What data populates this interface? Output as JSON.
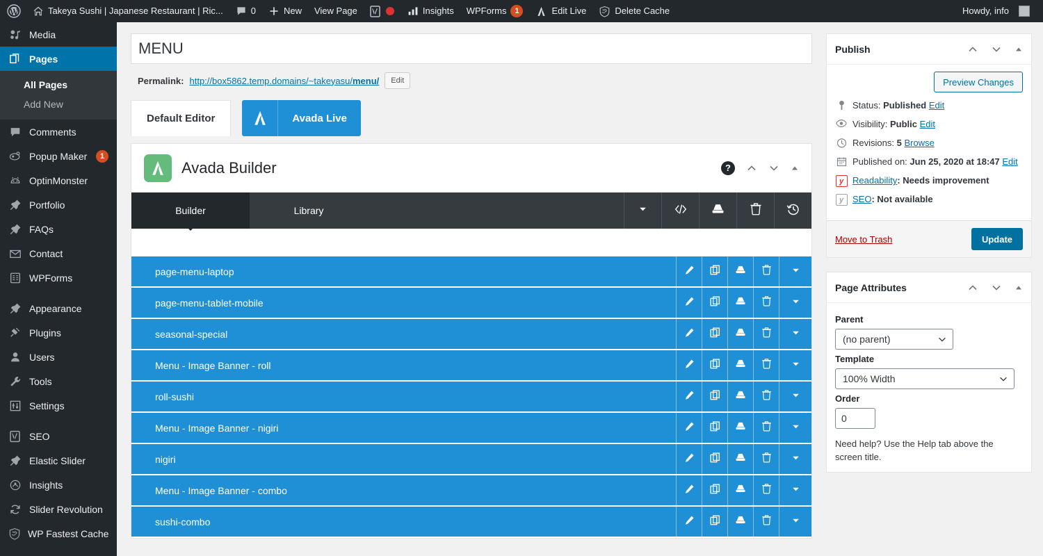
{
  "adminbar": {
    "wp_logo_icon": "wordpress-logo-icon",
    "site_icon": "home-icon",
    "site_title": "Takeya Sushi | Japanese Restaurant | Ric...",
    "comments_icon": "comment-bubble-icon",
    "comments_count": "0",
    "new_icon": "plus-icon",
    "new_label": "New",
    "view_page_label": "View Page",
    "yoast_icon": "yoast-seo-icon",
    "yoast_status_icon": "red-dot-icon",
    "insights_icon": "bar-chart-icon",
    "insights_label": "Insights",
    "wpforms_label": "WPForms",
    "wpforms_badge": "1",
    "edit_live_icon": "avada-icon",
    "edit_live_label": "Edit Live",
    "delete_cache_icon": "wp-fastest-cache-icon",
    "delete_cache_label": "Delete Cache",
    "howdy_label": "Howdy, info",
    "avatar_name": "user-avatar"
  },
  "sidebar": {
    "items": [
      {
        "label": "Media",
        "icon": "media-icon",
        "current": false
      },
      {
        "label": "Pages",
        "icon": "pages-icon",
        "current": true
      },
      {
        "label": "Comments",
        "icon": "comment-icon",
        "current": false
      },
      {
        "label": "Popup Maker",
        "icon": "popup-maker-icon",
        "current": false,
        "badge": "1"
      },
      {
        "label": "OptinMonster",
        "icon": "optinmonster-icon",
        "current": false
      },
      {
        "label": "Portfolio",
        "icon": "pin-icon",
        "current": false
      },
      {
        "label": "FAQs",
        "icon": "pin-icon",
        "current": false
      },
      {
        "label": "Contact",
        "icon": "envelope-icon",
        "current": false
      },
      {
        "label": "WPForms",
        "icon": "wpforms-icon",
        "current": false
      },
      {
        "label": "Appearance",
        "icon": "paintbrush-icon",
        "current": false,
        "separator_before": true
      },
      {
        "label": "Plugins",
        "icon": "plug-icon",
        "current": false
      },
      {
        "label": "Users",
        "icon": "user-icon",
        "current": false
      },
      {
        "label": "Tools",
        "icon": "wrench-icon",
        "current": false
      },
      {
        "label": "Settings",
        "icon": "settings-sliders-icon",
        "current": false
      },
      {
        "label": "SEO",
        "icon": "yoast-seo-icon",
        "current": false,
        "separator_before": true
      },
      {
        "label": "Elastic Slider",
        "icon": "pin-icon",
        "current": false
      },
      {
        "label": "Insights",
        "icon": "insights-icon",
        "current": false
      },
      {
        "label": "Slider Revolution",
        "icon": "refresh-icon",
        "current": false
      },
      {
        "label": "WP Fastest Cache",
        "icon": "wp-fastest-cache-icon",
        "current": false
      }
    ],
    "submenu": [
      {
        "label": "All Pages",
        "current": true
      },
      {
        "label": "Add New",
        "current": false
      }
    ]
  },
  "editor": {
    "title_value": "MENU",
    "title_placeholder": "Add title",
    "permalink_label": "Permalink:",
    "permalink_prefix": "http://box5862.temp.domains/~takeyasu/",
    "permalink_slug": "menu/",
    "permalink_edit_label": "Edit",
    "default_editor_label": "Default Editor",
    "avada_live_label": "Avada Live",
    "avada_live_icon": "avada-icon"
  },
  "builder": {
    "logo_icon": "avada-logo-icon",
    "title": "Avada Builder",
    "help_icon": "help-question-icon",
    "collapse_up_icon": "chevron-up-icon",
    "collapse_down_icon": "chevron-down-icon",
    "toggle_icon": "triangle-up-icon",
    "tabs": [
      {
        "label": "Builder",
        "active": true
      },
      {
        "label": "Library",
        "active": false
      }
    ],
    "tools": [
      {
        "name": "dropdown-toggle",
        "icon": "caret-down-icon"
      },
      {
        "name": "code-block",
        "icon": "code-icon"
      },
      {
        "name": "save-to-library",
        "icon": "save-disk-icon"
      },
      {
        "name": "delete-all",
        "icon": "trash-icon"
      },
      {
        "name": "history",
        "icon": "history-clock-icon"
      }
    ],
    "rows": [
      {
        "label": "page-menu-laptop"
      },
      {
        "label": "page-menu-tablet-mobile"
      },
      {
        "label": "seasonal-special"
      },
      {
        "label": "Menu - Image Banner - roll"
      },
      {
        "label": "roll-sushi"
      },
      {
        "label": "Menu - Image Banner - nigiri"
      },
      {
        "label": "nigiri"
      },
      {
        "label": "Menu - Image Banner - combo"
      },
      {
        "label": "sushi-combo"
      }
    ],
    "row_actions": [
      {
        "name": "edit-row",
        "icon": "pencil-icon"
      },
      {
        "name": "clone-row",
        "icon": "clone-icon"
      },
      {
        "name": "save-row",
        "icon": "save-disk-icon"
      },
      {
        "name": "delete-row",
        "icon": "trash-icon"
      },
      {
        "name": "row-options",
        "icon": "caret-down-icon"
      }
    ]
  },
  "publish": {
    "panel_title": "Publish",
    "preview_label": "Preview Changes",
    "status_icon": "pin-marker-icon",
    "status_label": "Status:",
    "status_value": "Published",
    "status_edit": "Edit",
    "visibility_icon": "eye-icon",
    "visibility_label": "Visibility:",
    "visibility_value": "Public",
    "visibility_edit": "Edit",
    "revisions_icon": "clock-icon",
    "revisions_label": "Revisions:",
    "revisions_value": "5",
    "revisions_browse": "Browse",
    "published_icon": "calendar-icon",
    "published_label": "Published on:",
    "published_value": "Jun 25, 2020 at 18:47",
    "published_edit": "Edit",
    "readability_icon": "yoast-readability-icon",
    "readability_label": "Readability",
    "readability_value": ": Needs improvement",
    "seo_icon": "yoast-seo-icon",
    "seo_label": "SEO",
    "seo_value": ": Not available",
    "trash_label": "Move to Trash",
    "update_label": "Update"
  },
  "page_attributes": {
    "panel_title": "Page Attributes",
    "parent_label": "Parent",
    "parent_value": "(no parent)",
    "template_label": "Template",
    "template_value": "100% Width",
    "order_label": "Order",
    "order_value": "0",
    "help_text": "Need help? Use the Help tab above the screen title."
  },
  "colors": {
    "admin_dark": "#23282d",
    "admin_current": "#0073aa",
    "row_blue": "#1f8fd6",
    "avada_green": "#65bb7c",
    "badge_orange": "#d54e21",
    "trash_red": "#a00000",
    "link_blue": "#0073aa"
  }
}
